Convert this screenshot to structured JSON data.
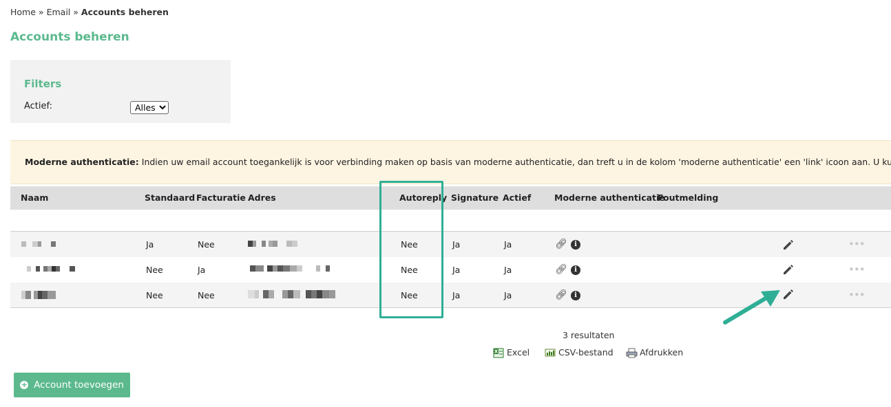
{
  "breadcrumb": {
    "home": "Home",
    "email": "Email",
    "current": "Accounts beheren",
    "separator": "»"
  },
  "page_title": "Accounts beheren",
  "filters": {
    "title": "Filters",
    "actief_label": "Actief:",
    "actief_value": "Alles"
  },
  "notice": {
    "strong": "Moderne authenticatie:",
    "text": "Indien uw email account toegankelijk is voor verbinding maken op basis van moderne authenticatie, dan treft u in de kolom 'moderne authenticatie' een 'link' icoon aan. U kunt hier op klikken om"
  },
  "table": {
    "headers": {
      "naam": "Naam",
      "standaard": "Standaard",
      "facturatie": "Facturatie",
      "adres": "Adres",
      "autoreply": "Autoreply",
      "signature": "Signature",
      "actief": "Actief",
      "moderne_authenticatie": "Moderne authenticatie",
      "foutmelding": "Foutmelding"
    },
    "rows": [
      {
        "standaard": "Ja",
        "facturatie": "Nee",
        "autoreply": "Nee",
        "signature": "Ja",
        "actief": "Ja"
      },
      {
        "standaard": "Nee",
        "facturatie": "Ja",
        "autoreply": "Nee",
        "signature": "Ja",
        "actief": "Ja"
      },
      {
        "standaard": "Nee",
        "facturatie": "Nee",
        "autoreply": "Nee",
        "signature": "Ja",
        "actief": "Ja"
      }
    ]
  },
  "icons": {
    "link": "link-icon",
    "info": "info-icon",
    "edit": "pencil-icon",
    "more": "more-dots-icon"
  },
  "results_text": "3 resultaten",
  "export": {
    "excel": "Excel",
    "csv": "CSV-bestand",
    "print": "Afdrukken"
  },
  "add_button": "Account toevoegen",
  "colors": {
    "accent": "#5cb98e",
    "highlight": "#2fae96",
    "notice_bg": "#fdf4e2",
    "header_bg": "#dedede"
  }
}
